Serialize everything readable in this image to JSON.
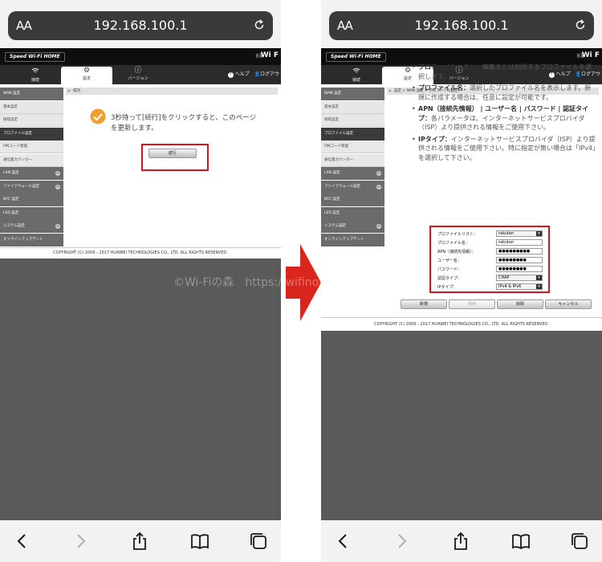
{
  "browser": {
    "aa_label": "AA",
    "url": "192.168.100.1"
  },
  "router": {
    "logo": "Speed Wi-Fi HOME",
    "language": "言語",
    "wifi_mark": "Wi F",
    "tabs": {
      "connection": "接続",
      "settings": "設定",
      "version": "バージョン"
    },
    "help": "ヘルプ",
    "logout_left": "ログアウ",
    "logout_right": "ログアウ",
    "sidebar": {
      "wan": "WAN 設定",
      "basic": "基本設定",
      "connection": "接続設定",
      "profile": "プロファイル設定",
      "pin": "PINコード管理",
      "traffic": "通信量カウンター",
      "lan": "LAN 設定",
      "firewall": "ファイアウォール設定",
      "nfc": "NFC 設定",
      "led": "LED 設定",
      "system": "システム設定",
      "online_update": "オンラインアップデート"
    },
    "footer": "COPYRIGHT (C) 2009 - 2017 HUAWEI TECHNOLOGIES CO., LTD. ALL RIGHTS RESERVED."
  },
  "left_screen": {
    "breadcrumb": "成功",
    "message_line1": "3秒待って[続行]をクリックすると、このページ",
    "message_line2": "を更新します。",
    "continue_button": "続行"
  },
  "right_screen": {
    "breadcrumb": "設定 > WAN 設定 > プロファイル設定",
    "help_items": [
      {
        "term": "プロファイルリスト：",
        "text": "編集または削除するプロファイルを選択します。"
      },
      {
        "term": "プロファイル名：",
        "text": "選択したプロファイル名を表示します。新規に作成する場合は、任意に設定が可能です。"
      },
      {
        "term": "APN（接続先情報） | ユーザー名 | パスワード | 認証タイプ：",
        "text": "各パラメータは、インターネットサービスプロバイダ（ISP）より提供される情報をご使用下さい。"
      },
      {
        "term": "IPタイプ：",
        "text": "インターネットサービスプロバイダ（ISP）より提供される情報をご使用下さい。特に指定が無い場合は「IPv4」を選択して下さい。"
      }
    ],
    "form": {
      "profile_list_label": "プロファイルリスト：",
      "profile_list_value": "rakuten",
      "profile_name_label": "プロファイル名：",
      "profile_name_value": "rakuten",
      "apn_label": "APN（接続先情報）：",
      "apn_value": "●●●●●●●●●",
      "username_label": "ユーザー名：",
      "username_value": "●●●●●●●●",
      "password_label": "パスワード：",
      "password_value": "●●●●●●●●",
      "auth_label": "認証タイプ：",
      "auth_value": "CHAP",
      "iptype_label": "IPタイプ：",
      "iptype_value": "IPv4 & IPv6"
    },
    "buttons": {
      "new": "新規",
      "save": "保存",
      "delete": "削除",
      "cancel": "キャンセル"
    }
  },
  "watermark": "©Wi-Fiの森　https://wifinomori.com",
  "colors": {
    "highlight": "#d4151e",
    "arrow": "#d9261c",
    "success_check": "#f0a030"
  },
  "icons": {
    "reload": "reload-icon",
    "back": "back-arrow-icon",
    "forward": "forward-arrow-icon",
    "share": "share-icon",
    "bookmarks": "book-icon",
    "tabs": "tabs-icon"
  }
}
